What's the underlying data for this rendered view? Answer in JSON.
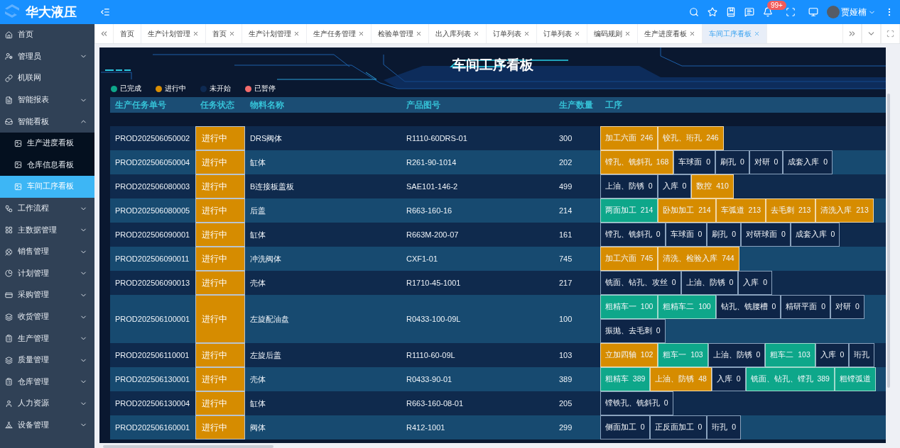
{
  "header": {
    "brand": "华大液压",
    "notification_badge": "99+",
    "user_name": "贾娅楠"
  },
  "sidebar": {
    "items": [
      {
        "label": "首页",
        "selected": false
      },
      {
        "label": "管理员",
        "selected": false,
        "expanded": false
      },
      {
        "label": "机联网",
        "selected": false
      },
      {
        "label": "智能报表",
        "selected": false,
        "expanded": false
      },
      {
        "label": "智能看板",
        "selected": false,
        "expanded": true,
        "children": [
          {
            "label": "生产进度看板",
            "selected": false
          },
          {
            "label": "仓库信息看板",
            "selected": false
          },
          {
            "label": "车间工序看板",
            "selected": true
          }
        ]
      },
      {
        "label": "工作流程",
        "selected": false,
        "expanded": false
      },
      {
        "label": "主数据管理",
        "selected": false,
        "expanded": false
      },
      {
        "label": "销售管理",
        "selected": false,
        "expanded": false
      },
      {
        "label": "计划管理",
        "selected": false,
        "expanded": false
      },
      {
        "label": "采购管理",
        "selected": false,
        "expanded": false
      },
      {
        "label": "收货管理",
        "selected": false,
        "expanded": false
      },
      {
        "label": "生产管理",
        "selected": false,
        "expanded": false
      },
      {
        "label": "质量管理",
        "selected": false,
        "expanded": false
      },
      {
        "label": "仓库管理",
        "selected": false,
        "expanded": false
      },
      {
        "label": "人力资源",
        "selected": false,
        "expanded": false
      },
      {
        "label": "设备管理",
        "selected": false,
        "expanded": false
      }
    ]
  },
  "tabs": [
    {
      "label": "首页",
      "selected": false,
      "closable": false
    },
    {
      "label": "生产计划管理",
      "selected": false,
      "closable": true
    },
    {
      "label": "首页",
      "selected": false,
      "closable": true
    },
    {
      "label": "生产计划管理",
      "selected": false,
      "closable": true
    },
    {
      "label": "生产任务管理",
      "selected": false,
      "closable": true
    },
    {
      "label": "检验单管理",
      "selected": false,
      "closable": true
    },
    {
      "label": "出入库列表",
      "selected": false,
      "closable": true
    },
    {
      "label": "订单列表",
      "selected": false,
      "closable": true
    },
    {
      "label": "订单列表",
      "selected": false,
      "closable": true
    },
    {
      "label": "编码规则",
      "selected": false,
      "closable": true
    },
    {
      "label": "生产进度看板",
      "selected": false,
      "closable": true
    },
    {
      "label": "车间工序看板",
      "selected": true,
      "closable": true
    }
  ],
  "board": {
    "title": "车间工序看板",
    "legend": [
      {
        "label": "已完成",
        "color": "#0ea78a"
      },
      {
        "label": "进行中",
        "color": "#d98e04"
      },
      {
        "label": "未开始",
        "color": "#0e2a52"
      },
      {
        "label": "已暂停",
        "color": "#f36c6c"
      }
    ],
    "columns": [
      "生产任务单号",
      "任务状态",
      "物料名称",
      "产品图号",
      "生产数量",
      "工序"
    ],
    "rows": [
      {
        "task_no": "PROD202506050002",
        "status": "进行中",
        "material": "DRS阀体",
        "drawing_no": "R1110-60DRS-01",
        "quantity": "300",
        "process_lines": [
          [
            {
              "label": "加工六面  246",
              "kind": "active"
            },
            {
              "label": "铰孔、珩孔  246",
              "kind": "active"
            }
          ]
        ]
      },
      {
        "task_no": "PROD202506050004",
        "status": "进行中",
        "material": "缸体",
        "drawing_no": "R261-90-1014",
        "quantity": "202",
        "process_lines": [
          [
            {
              "label": "镗孔、铣斜孔  168",
              "kind": "active"
            },
            {
              "label": "车球面  0",
              "kind": "idle"
            },
            {
              "label": "刷孔  0",
              "kind": "idle"
            },
            {
              "label": "对研  0",
              "kind": "idle"
            },
            {
              "label": "成套入库  0",
              "kind": "idle"
            }
          ]
        ]
      },
      {
        "task_no": "PROD202506080003",
        "status": "进行中",
        "material": "B连接板盖板",
        "drawing_no": "SAE101-146-2",
        "quantity": "499",
        "process_lines": [
          [
            {
              "label": "上油、防锈  0",
              "kind": "idle"
            },
            {
              "label": "入库  0",
              "kind": "idle"
            },
            {
              "label": "数控  410",
              "kind": "active"
            }
          ]
        ]
      },
      {
        "task_no": "PROD202506080005",
        "status": "进行中",
        "material": "后盖",
        "drawing_no": "R663-160-16",
        "quantity": "214",
        "process_lines": [
          [
            {
              "label": "两面加工  214",
              "kind": "done"
            },
            {
              "label": "卧加加工  214",
              "kind": "active"
            },
            {
              "label": "车弧道  213",
              "kind": "active"
            },
            {
              "label": "去毛刺  213",
              "kind": "active"
            },
            {
              "label": "清洗入库  213",
              "kind": "active"
            }
          ]
        ]
      },
      {
        "task_no": "PROD202506090001",
        "status": "进行中",
        "material": "缸体",
        "drawing_no": "R663M-200-07",
        "quantity": "161",
        "process_lines": [
          [
            {
              "label": "镗孔、铣斜孔  0",
              "kind": "idle"
            },
            {
              "label": "车球面  0",
              "kind": "idle"
            },
            {
              "label": "刷孔  0",
              "kind": "idle"
            },
            {
              "label": "对研球面  0",
              "kind": "idle"
            },
            {
              "label": "成套入库  0",
              "kind": "idle"
            }
          ]
        ]
      },
      {
        "task_no": "PROD202506090011",
        "status": "进行中",
        "material": "冲洗阀体",
        "drawing_no": "CXF1-01",
        "quantity": "745",
        "process_lines": [
          [
            {
              "label": "加工六面  745",
              "kind": "active"
            },
            {
              "label": "清洗、检验入库  744",
              "kind": "active"
            }
          ]
        ]
      },
      {
        "task_no": "PROD202506090013",
        "status": "进行中",
        "material": "壳体",
        "drawing_no": "R1710-45-1001",
        "quantity": "217",
        "process_lines": [
          [
            {
              "label": "铣面、钻孔、攻丝  0",
              "kind": "idle"
            },
            {
              "label": "上油、防锈  0",
              "kind": "idle"
            },
            {
              "label": "入库  0",
              "kind": "idle"
            }
          ]
        ]
      },
      {
        "task_no": "PROD202506100001",
        "status": "进行中",
        "material": "左旋配油盘",
        "drawing_no": "R0433-100-09L",
        "quantity": "100",
        "process_lines": [
          [
            {
              "label": "粗精车一  100",
              "kind": "done"
            },
            {
              "label": "粗精车二  100",
              "kind": "done"
            },
            {
              "label": "钻孔、铣腰槽  0",
              "kind": "idle"
            },
            {
              "label": "精研平面  0",
              "kind": "idle"
            },
            {
              "label": "对研  0",
              "kind": "idle"
            }
          ],
          [
            {
              "label": "振抛、去毛刺  0",
              "kind": "idle"
            }
          ]
        ]
      },
      {
        "task_no": "PROD202506110001",
        "status": "进行中",
        "material": "左旋后盖",
        "drawing_no": "R1110-60-09L",
        "quantity": "103",
        "process_lines": [
          [
            {
              "label": "立加四轴  102",
              "kind": "active"
            },
            {
              "label": "粗车一  103",
              "kind": "done"
            },
            {
              "label": "上油、防锈  0",
              "kind": "idle"
            },
            {
              "label": "粗车二  103",
              "kind": "done"
            },
            {
              "label": "入库  0",
              "kind": "idle"
            },
            {
              "label": "珩孔",
              "kind": "idle"
            }
          ]
        ]
      },
      {
        "task_no": "PROD202506130001",
        "status": "进行中",
        "material": "壳体",
        "drawing_no": "R0433-90-01",
        "quantity": "389",
        "process_lines": [
          [
            {
              "label": "粗精车  389",
              "kind": "done"
            },
            {
              "label": "上油、防锈  48",
              "kind": "active"
            },
            {
              "label": "入库  0",
              "kind": "idle"
            },
            {
              "label": "铣面、钻孔、镗孔  389",
              "kind": "done"
            },
            {
              "label": "粗镗弧道",
              "kind": "done"
            }
          ]
        ]
      },
      {
        "task_no": "PROD202506130004",
        "status": "进行中",
        "material": "缸体",
        "drawing_no": "R663-160-08-01",
        "quantity": "205",
        "process_lines": [
          [
            {
              "label": "镗铁孔、铣斜孔  0",
              "kind": "idle"
            }
          ]
        ]
      },
      {
        "task_no": "PROD202506160001",
        "status": "进行中",
        "material": "阀体",
        "drawing_no": "R412-1001",
        "quantity": "299",
        "process_lines": [
          [
            {
              "label": "侧面加工  0",
              "kind": "idle"
            },
            {
              "label": "正反面加工  0",
              "kind": "idle"
            },
            {
              "label": "珩孔  0",
              "kind": "idle"
            }
          ]
        ]
      }
    ]
  }
}
